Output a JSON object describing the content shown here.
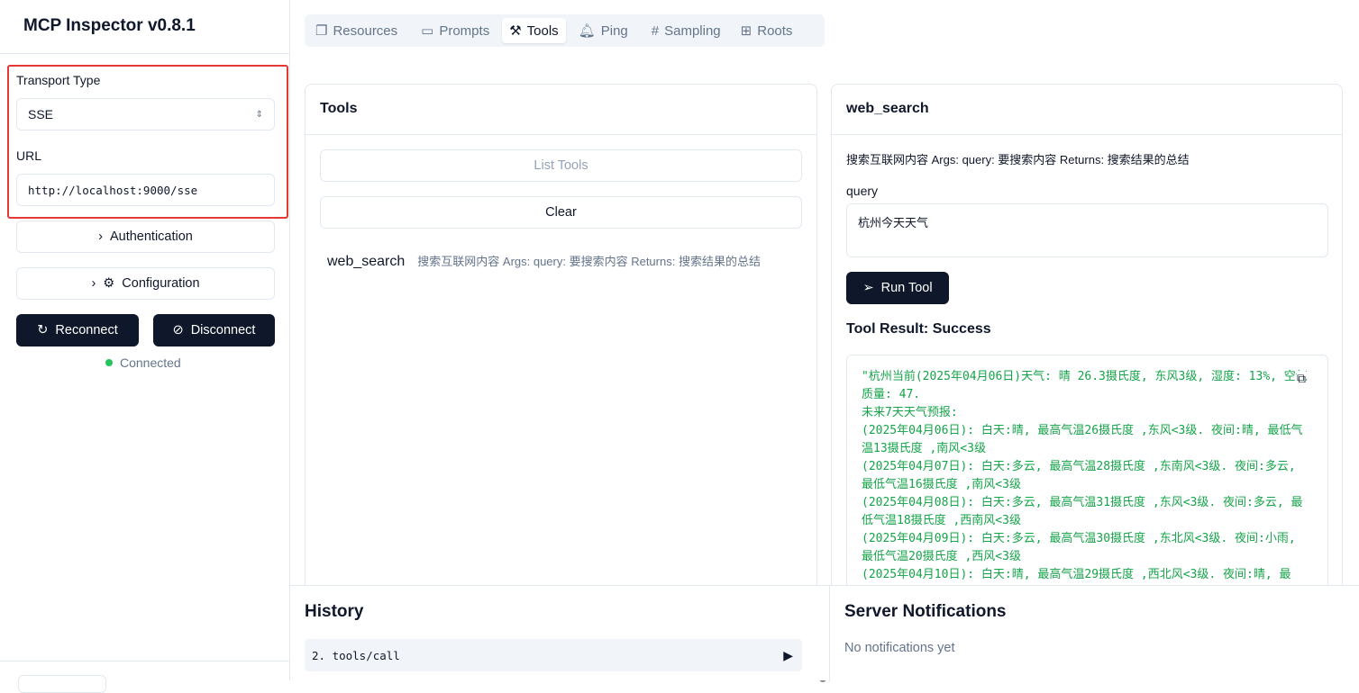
{
  "app": {
    "title": "MCP Inspector v0.8.1"
  },
  "sidebar": {
    "transport_label": "Transport Type",
    "transport_value": "SSE",
    "url_label": "URL",
    "url_value": "http://localhost:9000/sse",
    "authentication": "Authentication",
    "configuration": "Configuration",
    "reconnect": "Reconnect",
    "disconnect": "Disconnect",
    "status": "Connected",
    "status_color": "#22c55e"
  },
  "tabs": [
    {
      "label": "Resources"
    },
    {
      "label": "Prompts"
    },
    {
      "label": "Tools"
    },
    {
      "label": "Ping"
    },
    {
      "label": "Sampling"
    },
    {
      "label": "Roots"
    }
  ],
  "tools_panel": {
    "title": "Tools",
    "list_tools": "List Tools",
    "clear": "Clear",
    "items": [
      {
        "name": "web_search",
        "description": "搜索互联网内容 Args: query: 要搜索内容 Returns: 搜索结果的总结"
      }
    ]
  },
  "tool_detail": {
    "title": "web_search",
    "description": "搜索互联网内容 Args: query: 要搜索内容 Returns: 搜索结果的总结",
    "param_label": "query",
    "param_value": "杭州今天天气",
    "run": "Run Tool",
    "result_title": "Tool Result: Success",
    "result_text": "\"杭州当前(2025年04月06日)天气: 晴 26.3摄氏度, 东风3级, 湿度: 13%, 空气质量: 47.\n未来7天天气预报:\n(2025年04月06日): 白天:晴, 最高气温26摄氏度 ,东风<3级. 夜间:晴, 最低气温13摄氏度 ,南风<3级\n(2025年04月07日): 白天:多云, 最高气温28摄氏度 ,东南风<3级. 夜间:多云, 最低气温16摄氏度 ,南风<3级\n(2025年04月08日): 白天:多云, 最高气温31摄氏度 ,东风<3级. 夜间:多云, 最低气温18摄氏度 ,西南风<3级\n(2025年04月09日): 白天:多云, 最高气温30摄氏度 ,东北风<3级. 夜间:小雨, 最低气温20摄氏度 ,西风<3级\n(2025年04月10日): 白天:晴, 最高气温29摄氏度 ,西北风<3级. 夜间:晴, 最"
  },
  "history": {
    "title": "History",
    "items": [
      {
        "label": "2. tools/call"
      }
    ]
  },
  "notifications": {
    "title": "Server Notifications",
    "empty": "No notifications yet"
  }
}
